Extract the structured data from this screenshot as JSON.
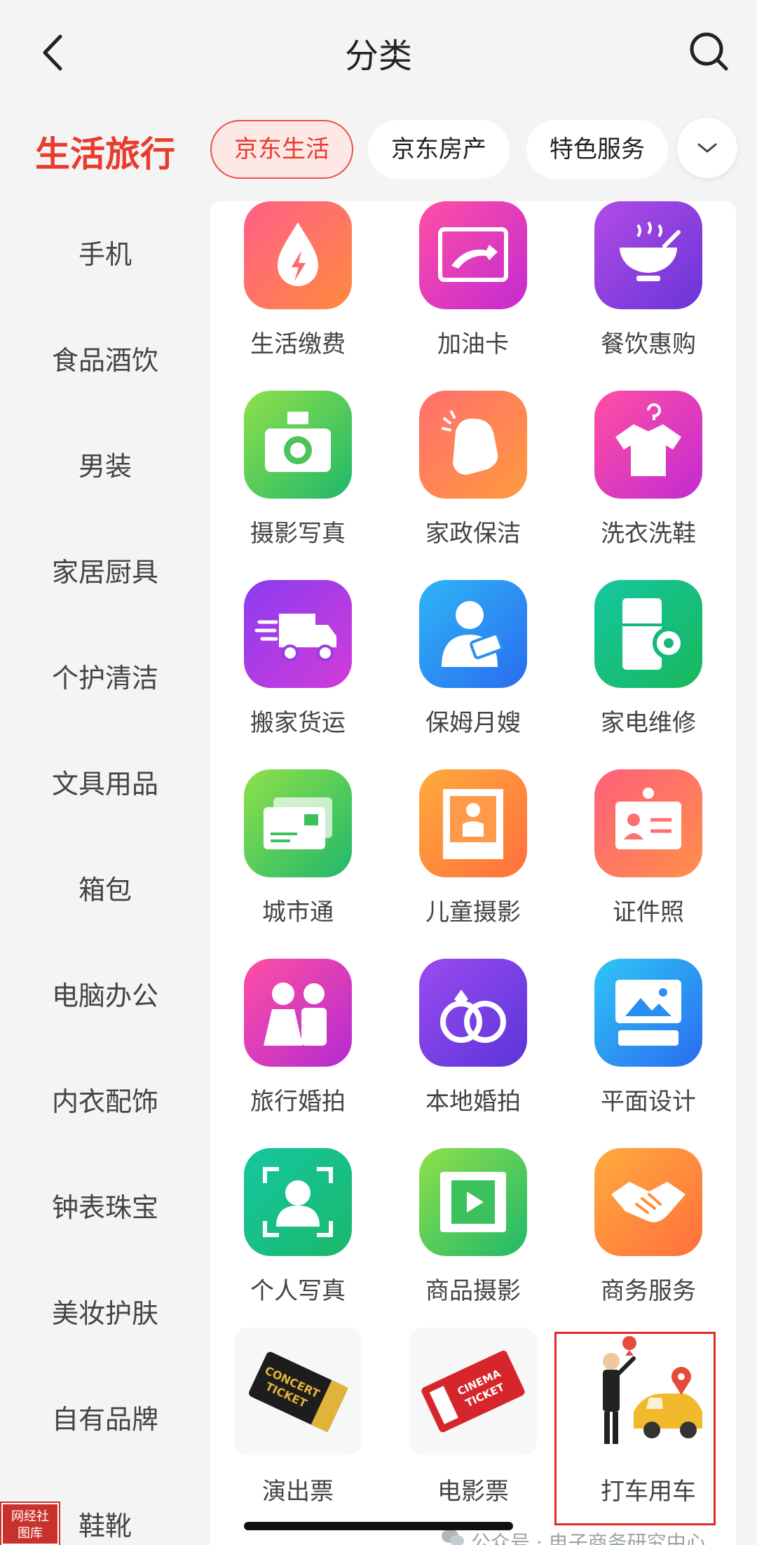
{
  "header": {
    "title": "分类",
    "back_icon": "chevron-left-icon",
    "search_icon": "search-icon"
  },
  "sidebar": {
    "active": "生活旅行",
    "items": [
      "手机",
      "食品酒饮",
      "男装",
      "家居厨具",
      "个护清洁",
      "文具用品",
      "箱包",
      "电脑办公",
      "内衣配饰",
      "钟表珠宝",
      "美妆护肤",
      "自有品牌",
      "鞋靴"
    ]
  },
  "subtabs": {
    "chips": [
      "京东生活",
      "京东房产",
      "特色服务"
    ],
    "active_chip": "京东生活",
    "expand_icon": "chevron-down-icon"
  },
  "grid": {
    "items": [
      {
        "label": "生活缴费",
        "icon": "water-drop-bolt-icon"
      },
      {
        "label": "加油卡",
        "icon": "fuel-card-icon"
      },
      {
        "label": "餐饮惠购",
        "icon": "bowl-icon"
      },
      {
        "label": "摄影写真",
        "icon": "camera-icon"
      },
      {
        "label": "家政保洁",
        "icon": "cleaning-glove-icon"
      },
      {
        "label": "洗衣洗鞋",
        "icon": "shirt-hanger-icon"
      },
      {
        "label": "搬家货运",
        "icon": "truck-icon"
      },
      {
        "label": "保姆月嫂",
        "icon": "nanny-icon"
      },
      {
        "label": "家电维修",
        "icon": "fridge-gear-icon"
      },
      {
        "label": "城市通",
        "icon": "city-card-icon"
      },
      {
        "label": "儿童摄影",
        "icon": "child-photo-icon"
      },
      {
        "label": "证件照",
        "icon": "id-badge-icon"
      },
      {
        "label": "旅行婚拍",
        "icon": "couple-icon"
      },
      {
        "label": "本地婚拍",
        "icon": "rings-icon"
      },
      {
        "label": "平面设计",
        "icon": "monitor-keyboard-icon"
      },
      {
        "label": "个人写真",
        "icon": "portrait-frame-icon"
      },
      {
        "label": "商品摄影",
        "icon": "film-play-icon"
      },
      {
        "label": "商务服务",
        "icon": "handshake-icon"
      },
      {
        "label": "演出票",
        "icon": "concert-ticket-icon"
      },
      {
        "label": "电影票",
        "icon": "cinema-ticket-icon"
      },
      {
        "label": "打车用车",
        "icon": "taxi-hail-icon"
      }
    ]
  },
  "colors": {
    "accent": "#e93b2e",
    "highlight": "#e02a2a"
  },
  "watermark": {
    "text": "公众号 · 电子商务研究中心"
  },
  "stamp": {
    "line1": "网经社",
    "line2": "图库"
  }
}
